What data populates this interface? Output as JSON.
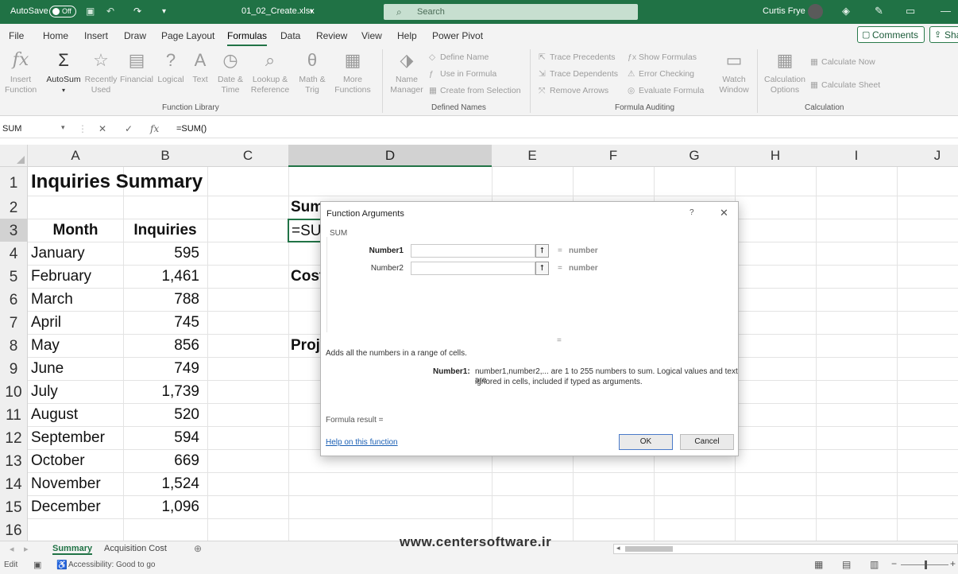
{
  "titlebar": {
    "autosave_label": "AutoSave",
    "autosave_state": "Off",
    "filename": "01_02_Create.xlsx",
    "search_placeholder": "Search",
    "user_name": "Curtis Frye"
  },
  "tabs": [
    "File",
    "Home",
    "Insert",
    "Draw",
    "Page Layout",
    "Formulas",
    "Data",
    "Review",
    "View",
    "Help",
    "Power Pivot"
  ],
  "active_tab": "Formulas",
  "comments_label": "Comments",
  "share_label": "Sha",
  "ribbon": {
    "insert_function": [
      "Insert",
      "Function"
    ],
    "autosum": "AutoSum",
    "recently_used": [
      "Recently",
      "Used"
    ],
    "financial": "Financial",
    "logical": "Logical",
    "text": "Text",
    "date_time": [
      "Date &",
      "Time"
    ],
    "lookup_reference": [
      "Lookup &",
      "Reference"
    ],
    "math_trig": [
      "Math &",
      "Trig"
    ],
    "more_functions": [
      "More",
      "Functions"
    ],
    "group_function_library": "Function Library",
    "name_manager": [
      "Name",
      "Manager"
    ],
    "define_name": "Define Name",
    "use_in_formula": "Use in Formula",
    "create_from_selection": "Create from Selection",
    "group_defined_names": "Defined Names",
    "trace_precedents": "Trace Precedents",
    "trace_dependents": "Trace Dependents",
    "remove_arrows": "Remove Arrows",
    "show_formulas": "Show Formulas",
    "error_checking": "Error Checking",
    "evaluate_formula": "Evaluate Formula",
    "watch_window": [
      "Watch",
      "Window"
    ],
    "group_formula_auditing": "Formula Auditing",
    "calculation_options": [
      "Calculation",
      "Options"
    ],
    "calculate_now": "Calculate Now",
    "calculate_sheet": "Calculate Sheet",
    "group_calculation": "Calculation"
  },
  "formula_bar": {
    "name_box": "SUM",
    "formula": "=SUM()"
  },
  "columns": [
    "A",
    "B",
    "C",
    "D",
    "E",
    "F",
    "G",
    "H",
    "I",
    "J"
  ],
  "rows": [
    "1",
    "2",
    "3",
    "4",
    "5",
    "6",
    "7",
    "8",
    "9",
    "10",
    "11",
    "12",
    "13",
    "14",
    "15",
    "16"
  ],
  "sheet": {
    "title": "Inquiries Summary",
    "header_month": "Month",
    "header_inquiries": "Inquiries",
    "data": [
      {
        "month": "January",
        "inquiries": "595"
      },
      {
        "month": "February",
        "inquiries": "1,461"
      },
      {
        "month": "March",
        "inquiries": "788"
      },
      {
        "month": "April",
        "inquiries": "745"
      },
      {
        "month": "May",
        "inquiries": "856"
      },
      {
        "month": "June",
        "inquiries": "749"
      },
      {
        "month": "July",
        "inquiries": "1,739"
      },
      {
        "month": "August",
        "inquiries": "520"
      },
      {
        "month": "September",
        "inquiries": "594"
      },
      {
        "month": "October",
        "inquiries": "669"
      },
      {
        "month": "November",
        "inquiries": "1,524"
      },
      {
        "month": "December",
        "inquiries": "1,096"
      }
    ],
    "d2": "Sum",
    "d3": "=SUM()",
    "d5": "Cost",
    "d8": "Proj"
  },
  "dialog": {
    "title": "Function Arguments",
    "help_icon": "?",
    "close_icon": "✕",
    "function_name": "SUM",
    "arg1_label": "Number1",
    "arg2_label": "Number2",
    "arg_eq": "=",
    "arg_value": "number",
    "result_eq": "=",
    "description": "Adds all the numbers in a range of cells.",
    "arg_desc_label": "Number1:",
    "arg_desc_text_1": "number1,number2,... are 1 to 255 numbers to sum. Logical values and text are",
    "arg_desc_text_2": "ignored in cells, included if typed as arguments.",
    "formula_result_label": "Formula result =",
    "help_link": "Help on this function",
    "ok_label": "OK",
    "cancel_label": "Cancel"
  },
  "sheet_tabs": [
    "Summary",
    "Acquisition Cost"
  ],
  "active_sheet": "Summary",
  "status": {
    "mode": "Edit",
    "accessibility": "Accessibility: Good to go"
  },
  "watermark": "www.centersoftware.ir",
  "colors": {
    "excel_green": "#217346",
    "titlebar_green": "#207245"
  }
}
